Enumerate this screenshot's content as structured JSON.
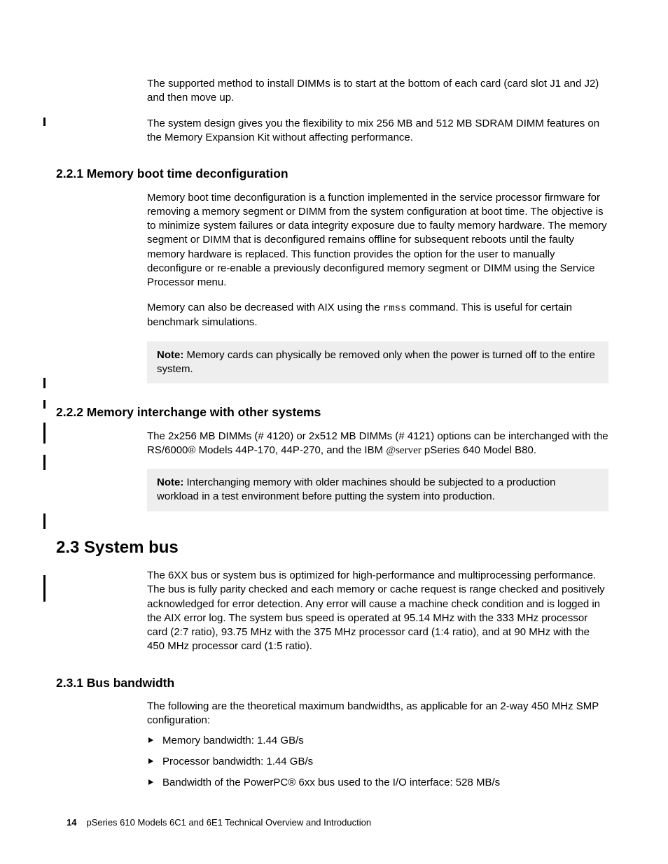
{
  "intro": {
    "p1": "The supported method to install DIMMs is to start at the bottom of each card (card slot J1 and J2) and then move up.",
    "p2": "The system design gives you the flexibility to mix 256 MB and 512 MB SDRAM DIMM features on the Memory Expansion Kit without affecting performance."
  },
  "sec221": {
    "heading": "2.2.1  Memory boot time deconfiguration",
    "p1": "Memory boot time deconfiguration is a function implemented in the service processor firmware for removing a memory segment or DIMM from the system configuration at boot time. The objective is to minimize system failures or data integrity exposure due to faulty memory hardware. The memory segment or DIMM that is deconfigured remains offline for subsequent reboots until the faulty memory hardware is replaced. This function provides the option for the user to manually deconfigure or re-enable a previously deconfigured memory segment or DIMM using the Service Processor menu.",
    "p2a": "Memory can also be decreased with AIX using the ",
    "p2cmd": "rmss",
    "p2b": " command. This is useful for certain benchmark simulations.",
    "note_label": "Note:",
    "note_body": " Memory cards can physically be removed only when the power is turned off to the entire system."
  },
  "sec222": {
    "heading": "2.2.2  Memory interchange with other systems",
    "p1a": "The 2x256 MB DIMMs (# 4120) or 2x512 MB DIMMs (# 4121) options can be interchanged with the RS/6000® Models 44P-170, 44P-270, and the IBM ",
    "eserver": "server",
    "p1b": " pSeries 640 Model B80.",
    "note_label": "Note:",
    "note_body": " Interchanging memory with older machines should be subjected to a production workload in a test environment before putting the system into production."
  },
  "sec23": {
    "heading": "2.3  System bus",
    "p1": "The 6XX bus or system bus is optimized for high-performance and multiprocessing performance. The bus is fully parity checked and each memory or cache request is range checked and positively acknowledged for error detection. Any error will cause a machine check condition and is logged in the AIX error log. The system bus speed is operated at 95.14 MHz with the 333 MHz processor card (2:7 ratio), 93.75 MHz with the 375 MHz processor card (1:4 ratio), and at 90 MHz with the 450 MHz processor card (1:5 ratio)."
  },
  "sec231": {
    "heading": "2.3.1  Bus bandwidth",
    "p1": "The following are the theoretical maximum bandwidths, as applicable for an 2-way 450 MHz SMP configuration:",
    "items": [
      "Memory bandwidth: 1.44 GB/s",
      "Processor bandwidth: 1.44 GB/s",
      "Bandwidth of the PowerPC® 6xx bus used to the I/O interface: 528 MB/s"
    ]
  },
  "footer": {
    "page": "14",
    "title": "pSeries 610 Models 6C1 and 6E1 Technical Overview and Introduction"
  }
}
